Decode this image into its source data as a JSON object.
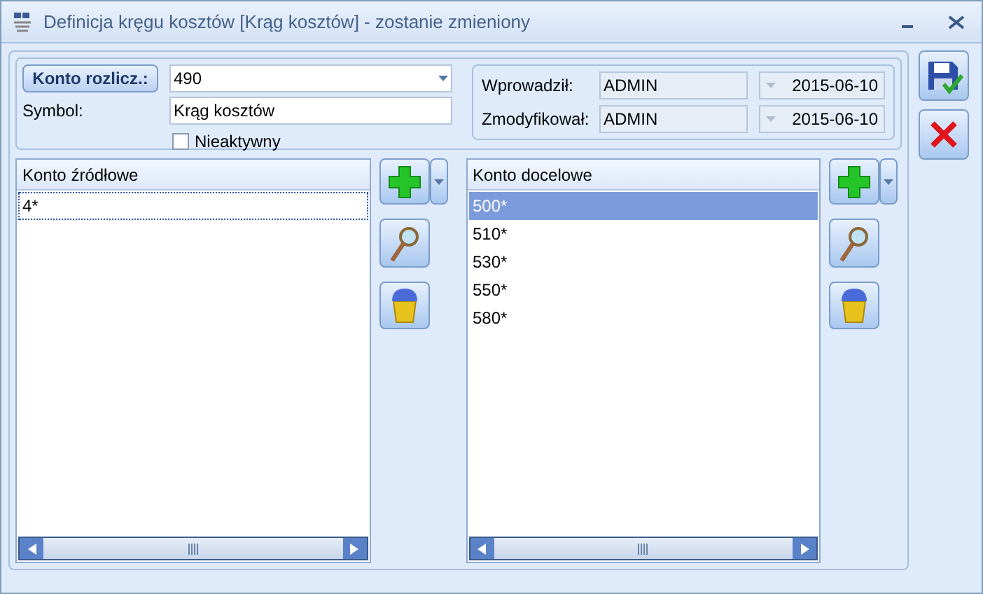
{
  "window": {
    "title": "Definicja kręgu kosztów [Krąg kosztów] - zostanie zmieniony"
  },
  "account": {
    "button": "Konto rozlicz.:",
    "value": "490"
  },
  "symbol": {
    "label": "Symbol:",
    "value": "Krąg kosztów"
  },
  "inactive": {
    "label": "Nieaktywny",
    "checked": false
  },
  "audit": [
    {
      "label": "Wprowadził:",
      "user": "ADMIN",
      "date": "2015-06-10"
    },
    {
      "label": "Zmodyfikował:",
      "user": "ADMIN",
      "date": "2015-06-10"
    }
  ],
  "lists": [
    {
      "header": "Konto źródłowe",
      "rows": [
        {
          "text": "4*",
          "selected": false,
          "focused": true
        }
      ]
    },
    {
      "header": "Konto docelowe",
      "rows": [
        {
          "text": "500*",
          "selected": true,
          "focused": false
        },
        {
          "text": "510*",
          "selected": false,
          "focused": false
        },
        {
          "text": "530*",
          "selected": false,
          "focused": false
        },
        {
          "text": "550*",
          "selected": false,
          "focused": false
        },
        {
          "text": "580*",
          "selected": false,
          "focused": false
        }
      ]
    }
  ]
}
